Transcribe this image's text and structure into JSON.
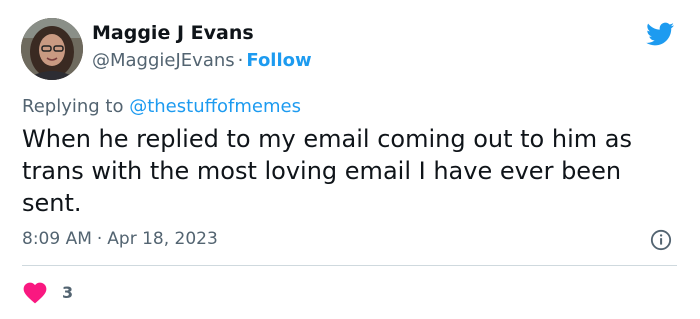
{
  "author": {
    "name": "Maggie J Evans",
    "handle": "@MaggieJEvans",
    "separator": "·",
    "follow_label": "Follow"
  },
  "reply": {
    "prefix": "Replying to",
    "mention": "@thestuffofmemes"
  },
  "tweet": {
    "text": "When he replied to my email coming out to him as trans with the most loving email I have ever been sent."
  },
  "meta": {
    "time": "8:09 AM",
    "separator": "·",
    "date": "Apr 18, 2023"
  },
  "engagement": {
    "likes": "3"
  },
  "icons": {
    "platform": "twitter-bird-icon",
    "info": "info-icon",
    "like": "heart-icon"
  },
  "colors": {
    "accent": "#1d9bf0",
    "heart": "#f91880",
    "text": "#0f1419",
    "muted": "#536471"
  }
}
